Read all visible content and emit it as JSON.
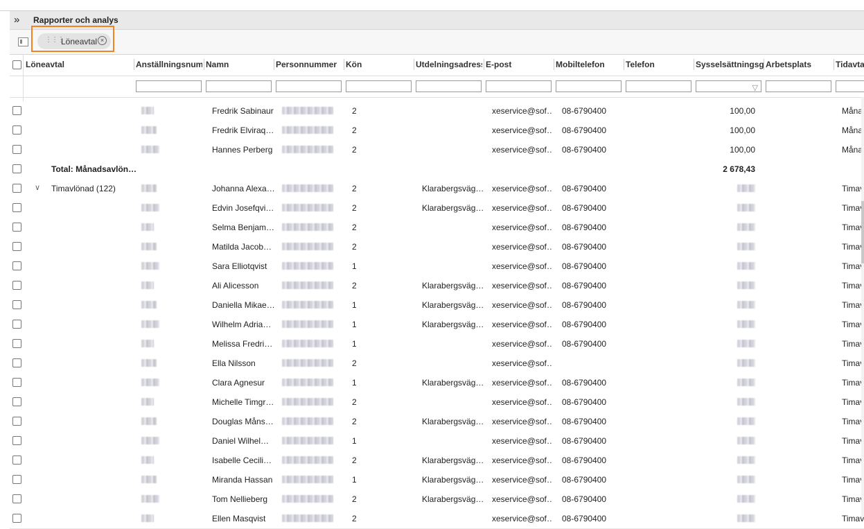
{
  "app": {
    "title": "Rapporter och analys"
  },
  "grouping": {
    "chip_label": "Löneavtal"
  },
  "columns": [
    "Löneavtal",
    "Anställningsnum…",
    "Namn",
    "Personnummer",
    "Kön",
    "Utdelningsadress",
    "E-post",
    "Mobiltelefon",
    "Telefon",
    "Sysselsättningsgr…",
    "Arbetsplats",
    "Tidavtal"
  ],
  "rows": [
    {
      "group": "",
      "name": "Fredrik Sabinaur",
      "kon": "2",
      "adress": "",
      "epost": "xeservice@sof…",
      "mobil": "08-6790400",
      "syss": "100,00",
      "tid": "Måna"
    },
    {
      "group": "",
      "name": "Fredrik Elviraq…",
      "kon": "2",
      "adress": "",
      "epost": "xeservice@sof…",
      "mobil": "08-6790400",
      "syss": "100,00",
      "tid": "Måna"
    },
    {
      "group": "",
      "name": "Hannes Perberg",
      "kon": "2",
      "adress": "",
      "epost": "xeservice@sof…",
      "mobil": "08-6790400",
      "syss": "100,00",
      "tid": "Måna"
    },
    {
      "total": true,
      "group": "Total: Månadsavlön…",
      "name": "",
      "kon": "",
      "adress": "",
      "epost": "",
      "mobil": "",
      "syss": "2 678,43",
      "tid": ""
    },
    {
      "group": "Timavlönad (122)",
      "expander": true,
      "name": "Johanna Alexa…",
      "kon": "2",
      "adress": "Klarabergsväg…",
      "epost": "xeservice@sof…",
      "mobil": "08-6790400",
      "syss": "",
      "tid": "Timav"
    },
    {
      "group": "",
      "name": "Edvin Josefqvi…",
      "kon": "2",
      "adress": "Klarabergsväg…",
      "epost": "xeservice@sof…",
      "mobil": "08-6790400",
      "syss": "",
      "tid": "Timav"
    },
    {
      "group": "",
      "name": "Selma Benjam…",
      "kon": "2",
      "adress": "",
      "epost": "xeservice@sof…",
      "mobil": "08-6790400",
      "syss": "",
      "tid": "Timav"
    },
    {
      "group": "",
      "name": "Matilda Jacob…",
      "kon": "2",
      "adress": "",
      "epost": "xeservice@sof…",
      "mobil": "08-6790400",
      "syss": "",
      "tid": "Timav"
    },
    {
      "group": "",
      "name": "Sara Elliotqvist",
      "kon": "1",
      "adress": "",
      "epost": "xeservice@sof…",
      "mobil": "08-6790400",
      "syss": "",
      "tid": "Timav"
    },
    {
      "group": "",
      "name": "Ali Alicesson",
      "kon": "2",
      "adress": "Klarabergsväg…",
      "epost": "xeservice@sof…",
      "mobil": "08-6790400",
      "syss": "",
      "tid": "Timav"
    },
    {
      "group": "",
      "name": "Daniella Mikae…",
      "kon": "1",
      "adress": "Klarabergsväg…",
      "epost": "xeservice@sof…",
      "mobil": "08-6790400",
      "syss": "",
      "tid": "Timav"
    },
    {
      "group": "",
      "name": "Wilhelm Adria…",
      "kon": "1",
      "adress": "Klarabergsväg…",
      "epost": "xeservice@sof…",
      "mobil": "08-6790400",
      "syss": "",
      "tid": "Timav"
    },
    {
      "group": "",
      "name": "Melissa Fredri…",
      "kon": "1",
      "adress": "",
      "epost": "xeservice@sof…",
      "mobil": "08-6790400",
      "syss": "",
      "tid": "Timav"
    },
    {
      "group": "",
      "name": "Ella Nilsson",
      "kon": "2",
      "adress": "",
      "epost": "xeservice@sof…",
      "mobil": "",
      "syss": "",
      "tid": "Timav"
    },
    {
      "group": "",
      "name": "Clara Agnesur",
      "kon": "1",
      "adress": "Klarabergsväg…",
      "epost": "xeservice@sof…",
      "mobil": "08-6790400",
      "syss": "",
      "tid": "Timav"
    },
    {
      "group": "",
      "name": "Michelle Timgr…",
      "kon": "2",
      "adress": "",
      "epost": "xeservice@sof…",
      "mobil": "08-6790400",
      "syss": "",
      "tid": "Timav"
    },
    {
      "group": "",
      "name": "Douglas Måns…",
      "kon": "2",
      "adress": "Klarabergsväg…",
      "epost": "xeservice@sof…",
      "mobil": "08-6790400",
      "syss": "",
      "tid": "Timav"
    },
    {
      "group": "",
      "name": "Daniel Wilhel…",
      "kon": "1",
      "adress": "",
      "epost": "xeservice@sof…",
      "mobil": "08-6790400",
      "syss": "",
      "tid": "Timav"
    },
    {
      "group": "",
      "name": "Isabelle Cecili…",
      "kon": "2",
      "adress": "Klarabergsväg…",
      "epost": "xeservice@sof…",
      "mobil": "08-6790400",
      "syss": "",
      "tid": "Timav"
    },
    {
      "group": "",
      "name": "Miranda Hassan",
      "kon": "1",
      "adress": "Klarabergsväg…",
      "epost": "xeservice@sof…",
      "mobil": "08-6790400",
      "syss": "",
      "tid": "Timav"
    },
    {
      "group": "",
      "name": "Tom Nellieberg",
      "kon": "2",
      "adress": "Klarabergsväg…",
      "epost": "xeservice@sof…",
      "mobil": "08-6790400",
      "syss": "",
      "tid": "Timav"
    },
    {
      "group": "",
      "name": "Ellen Masqvist",
      "kon": "2",
      "adress": "",
      "epost": "xeservice@sof…",
      "mobil": "08-6790400",
      "syss": "",
      "tid": "Timav"
    }
  ]
}
